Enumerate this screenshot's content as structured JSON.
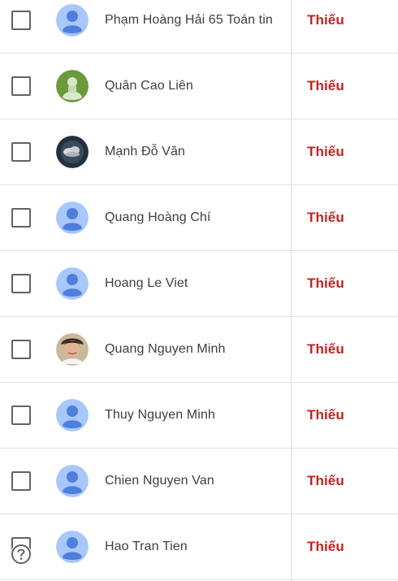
{
  "students": [
    {
      "name": "Phạm Hoàng Hải 65 Toán tin",
      "status": "Thiếu",
      "avatar": "default-avatar-icon"
    },
    {
      "name": "Quân Cao Liên",
      "status": "Thiếu",
      "avatar": "photo-avatar-green"
    },
    {
      "name": "Mạnh Đỗ Văn",
      "status": "Thiếu",
      "avatar": "photo-avatar-storm"
    },
    {
      "name": "Quang Hoàng Chí",
      "status": "Thiếu",
      "avatar": "default-avatar-icon"
    },
    {
      "name": "Hoang Le Viet",
      "status": "Thiếu",
      "avatar": "default-avatar-icon"
    },
    {
      "name": "Quang Nguyen Minh",
      "status": "Thiếu",
      "avatar": "photo-avatar-person"
    },
    {
      "name": "Thuy Nguyen Minh",
      "status": "Thiếu",
      "avatar": "default-avatar-icon"
    },
    {
      "name": "Chien Nguyen Van",
      "status": "Thiếu",
      "avatar": "default-avatar-icon"
    },
    {
      "name": "Hao Tran Tien",
      "status": "Thiếu",
      "avatar": "default-avatar-icon"
    }
  ],
  "help": {
    "icon": "help-circle-icon"
  },
  "colors": {
    "status_missing": "#c5221f",
    "default_avatar_bg": "#a8c7fa",
    "default_avatar_fg": "#4f7fdc"
  }
}
